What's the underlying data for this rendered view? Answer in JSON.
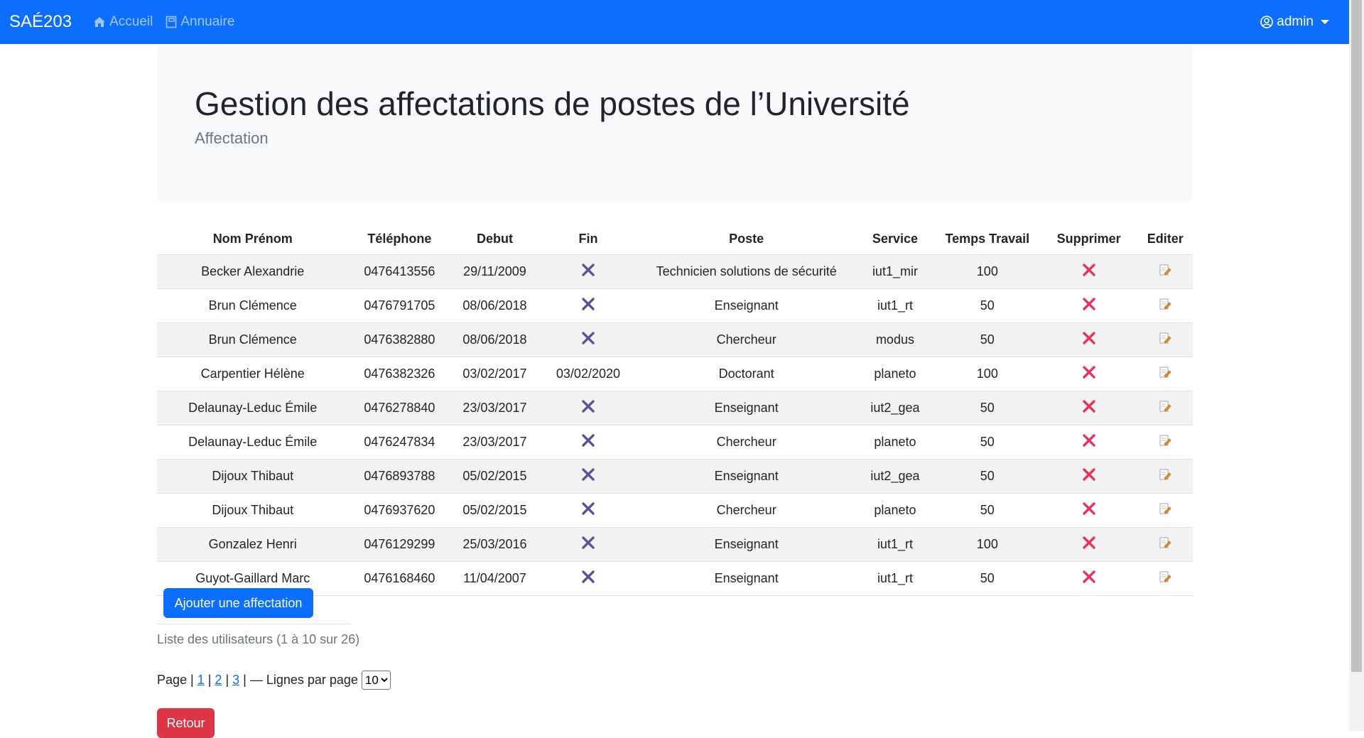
{
  "navbar": {
    "brand": "SAÉ203",
    "links": [
      {
        "label": "Accueil",
        "icon": "home-icon"
      },
      {
        "label": "Annuaire",
        "icon": "book-icon"
      }
    ],
    "user": {
      "label": "admin",
      "icon": "user-circle-icon"
    }
  },
  "jumbotron": {
    "title": "Gestion des affectations de postes de l’Université",
    "subtitle": "Affectation"
  },
  "table": {
    "headers": [
      "Nom Prénom",
      "Téléphone",
      "Debut",
      "Fin",
      "Poste",
      "Service",
      "Temps Travail",
      "Supprimer",
      "Editer"
    ],
    "rows": [
      {
        "name": "Becker Alexandrie",
        "tel": "0476413556",
        "debut": "29/11/2009",
        "fin": "",
        "poste": "Technicien solutions de sécurité",
        "service": "iut1_mir",
        "temps": "100"
      },
      {
        "name": "Brun Clémence",
        "tel": "0476791705",
        "debut": "08/06/2018",
        "fin": "",
        "poste": "Enseignant",
        "service": "iut1_rt",
        "temps": "50"
      },
      {
        "name": "Brun Clémence",
        "tel": "0476382880",
        "debut": "08/06/2018",
        "fin": "",
        "poste": "Chercheur",
        "service": "modus",
        "temps": "50"
      },
      {
        "name": "Carpentier Hélène",
        "tel": "0476382326",
        "debut": "03/02/2017",
        "fin": "03/02/2020",
        "poste": "Doctorant",
        "service": "planeto",
        "temps": "100"
      },
      {
        "name": "Delaunay-Leduc Émile",
        "tel": "0476278840",
        "debut": "23/03/2017",
        "fin": "",
        "poste": "Enseignant",
        "service": "iut2_gea",
        "temps": "50"
      },
      {
        "name": "Delaunay-Leduc Émile",
        "tel": "0476247834",
        "debut": "23/03/2017",
        "fin": "",
        "poste": "Chercheur",
        "service": "planeto",
        "temps": "50"
      },
      {
        "name": "Dijoux Thibaut",
        "tel": "0476893788",
        "debut": "05/02/2015",
        "fin": "",
        "poste": "Enseignant",
        "service": "iut2_gea",
        "temps": "50"
      },
      {
        "name": "Dijoux Thibaut",
        "tel": "0476937620",
        "debut": "05/02/2015",
        "fin": "",
        "poste": "Chercheur",
        "service": "planeto",
        "temps": "50"
      },
      {
        "name": "Gonzalez Henri",
        "tel": "0476129299",
        "debut": "25/03/2016",
        "fin": "",
        "poste": "Enseignant",
        "service": "iut1_rt",
        "temps": "100"
      },
      {
        "name": "Guyot-Gaillard Marc",
        "tel": "0476168460",
        "debut": "11/04/2007",
        "fin": "",
        "poste": "Enseignant",
        "service": "iut1_rt",
        "temps": "50"
      }
    ]
  },
  "actions": {
    "add_label": "Ajouter une affectation",
    "back_label": "Retour"
  },
  "list_info": "Liste des utilisateurs (1 à 10 sur 26)",
  "pagination": {
    "prefix": "Page |",
    "pages": [
      "1",
      "2",
      "3"
    ],
    "per_page_label": "| — Lignes par page",
    "per_page_value": "10",
    "per_page_options": [
      "10"
    ]
  },
  "colors": {
    "primary": "#0d6efd",
    "danger": "#dc3545",
    "delete_icon": "#e8345a",
    "no_end_icon": "#5b5398"
  }
}
